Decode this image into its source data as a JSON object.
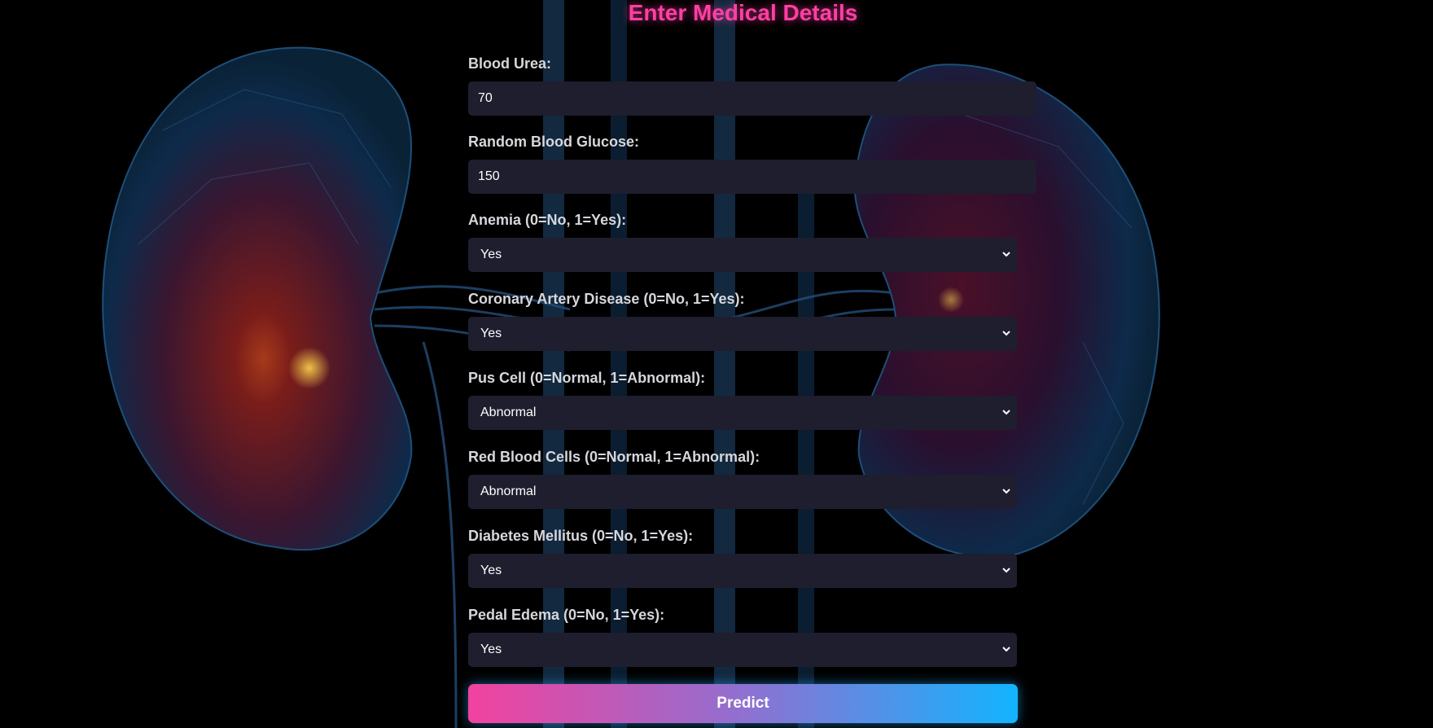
{
  "page": {
    "title": "Enter Medical Details",
    "accent_color": "#ff3fa4",
    "button_gradient": [
      "#f2429e",
      "#12b4ff"
    ]
  },
  "fields": {
    "blood_urea": {
      "label": "Blood Urea:",
      "value": "70"
    },
    "random_blood_glucose": {
      "label": "Random Blood Glucose:",
      "value": "150"
    },
    "anemia": {
      "label": "Anemia (0=No, 1=Yes):",
      "value": "Yes"
    },
    "coronary_artery_disease": {
      "label": "Coronary Artery Disease (0=No, 1=Yes):",
      "value": "Yes"
    },
    "pus_cell": {
      "label": "Pus Cell (0=Normal, 1=Abnormal):",
      "value": "Abnormal"
    },
    "red_blood_cells": {
      "label": "Red Blood Cells (0=Normal, 1=Abnormal):",
      "value": "Abnormal"
    },
    "diabetes_mellitus": {
      "label": "Diabetes Mellitus (0=No, 1=Yes):",
      "value": "Yes"
    },
    "pedal_edema": {
      "label": "Pedal Edema (0=No, 1=Yes):",
      "value": "Yes"
    }
  },
  "actions": {
    "predict_label": "Predict"
  },
  "background": {
    "image": "kidney-illustration",
    "icon": "chevron-down-icon"
  }
}
